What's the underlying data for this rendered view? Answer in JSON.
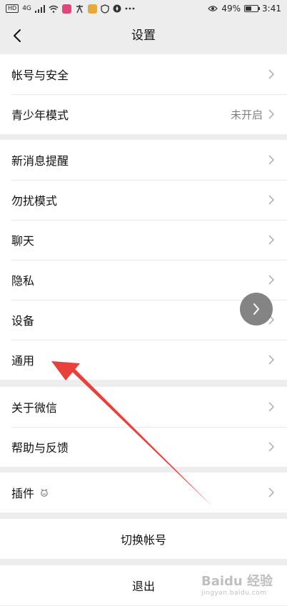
{
  "status_bar": {
    "hd": "HD",
    "network": "4G",
    "battery_percent": "49%",
    "battery_level": 0.49,
    "time": "3:41"
  },
  "nav": {
    "title": "设置"
  },
  "groups": [
    {
      "items": [
        {
          "label": "帐号与安全",
          "value": ""
        },
        {
          "label": "青少年模式",
          "value": "未开启"
        }
      ]
    },
    {
      "items": [
        {
          "label": "新消息提醒"
        },
        {
          "label": "勿扰模式"
        },
        {
          "label": "聊天"
        },
        {
          "label": "隐私"
        },
        {
          "label": "设备"
        },
        {
          "label": "通用"
        }
      ]
    },
    {
      "items": [
        {
          "label": "关于微信"
        },
        {
          "label": "帮助与反馈"
        }
      ]
    },
    {
      "items": [
        {
          "label": "插件"
        }
      ]
    }
  ],
  "actions": {
    "switch_account": "切换帐号",
    "logout": "退出"
  },
  "watermark": {
    "text": "Baidu 经验",
    "sub": "jingyan.baidu.com"
  },
  "colors": {
    "background": "#ededed",
    "annotation_arrow": "#e8403a"
  }
}
